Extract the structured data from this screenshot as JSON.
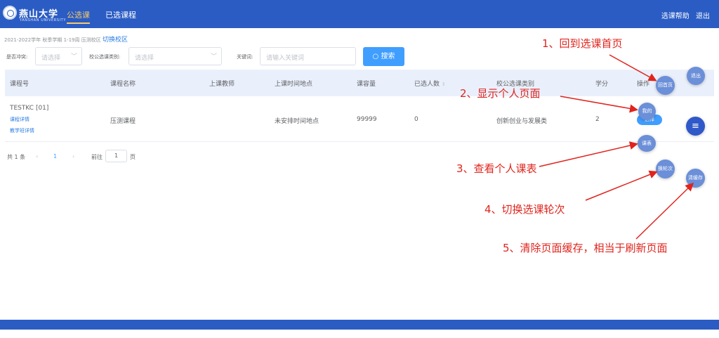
{
  "header": {
    "logo_text": "燕山大学",
    "logo_sub": "YANSHAN UNIVERSITY",
    "nav": [
      "公选课",
      "已选课程"
    ],
    "right_links": [
      "选课帮助",
      "退出"
    ]
  },
  "term": {
    "text": "2021-2022学年 秋季学期  1-19周  压测校区",
    "switch_label": "切换校区"
  },
  "filters": {
    "conflict_label": "是否冲突:",
    "conflict_placeholder": "请选择",
    "category_label": "校公选课类别:",
    "category_placeholder": "请选择",
    "keyword_label": "关键词:",
    "keyword_placeholder": "请输入关键词",
    "search_label": "搜索"
  },
  "table": {
    "columns": [
      "课程号",
      "课程名称",
      "上课教师",
      "上课时间地点",
      "课容量",
      "已选人数",
      "校公选课类别",
      "学分",
      "操作"
    ],
    "rows": [
      {
        "code": "TESTKC [01]",
        "detail_link": "课程详情",
        "class_detail_link": "教学班详情",
        "name": "压测课程",
        "teacher": "",
        "time_place": "未安排时间地点",
        "capacity": "99999",
        "selected": "0",
        "category": "创新创业与发展类",
        "credit": "2",
        "action": "选择"
      }
    ]
  },
  "pagination": {
    "total": "共 1 条",
    "current": "1",
    "goto_label": "前往",
    "goto_value": "1",
    "page_unit": "页"
  },
  "floating": {
    "logout": "退出",
    "home": "回首页",
    "mine": "我的",
    "timetable": "课表",
    "switch_round": "换轮次",
    "clear_cache": "清缓存"
  },
  "annotations": {
    "a1": "1、回到选课首页",
    "a2": "2、显示个人页面",
    "a3": "3、查看个人课表",
    "a4": "4、切换选课轮次",
    "a5": "5、清除页面缓存，相当于刷新页面"
  },
  "colors": {
    "primary": "#2a5cc4",
    "button": "#409eff",
    "annotation": "#e0241d"
  }
}
